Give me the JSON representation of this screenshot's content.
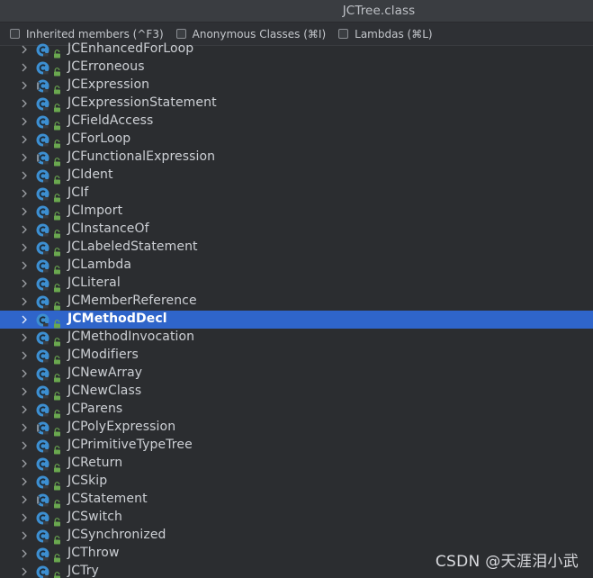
{
  "window": {
    "title": "JCTree.class"
  },
  "filters": [
    {
      "label": "Inherited members (^F3)",
      "checked": false
    },
    {
      "label": "Anonymous Classes (⌘I)",
      "checked": false
    },
    {
      "label": "Lambdas (⌘L)",
      "checked": false
    }
  ],
  "tree": {
    "icon": "class-icon",
    "access_icon": "lock-icon",
    "expand_icon": "chevron-right-icon",
    "selected_index": 15,
    "items": [
      {
        "label": "JCEnhancedForLoop",
        "abstract": false
      },
      {
        "label": "JCErroneous",
        "abstract": false
      },
      {
        "label": "JCExpression",
        "abstract": true
      },
      {
        "label": "JCExpressionStatement",
        "abstract": false
      },
      {
        "label": "JCFieldAccess",
        "abstract": false
      },
      {
        "label": "JCForLoop",
        "abstract": false
      },
      {
        "label": "JCFunctionalExpression",
        "abstract": true
      },
      {
        "label": "JCIdent",
        "abstract": false
      },
      {
        "label": "JCIf",
        "abstract": false
      },
      {
        "label": "JCImport",
        "abstract": false
      },
      {
        "label": "JCInstanceOf",
        "abstract": false
      },
      {
        "label": "JCLabeledStatement",
        "abstract": false
      },
      {
        "label": "JCLambda",
        "abstract": false
      },
      {
        "label": "JCLiteral",
        "abstract": false
      },
      {
        "label": "JCMemberReference",
        "abstract": false
      },
      {
        "label": "JCMethodDecl",
        "abstract": false
      },
      {
        "label": "JCMethodInvocation",
        "abstract": false
      },
      {
        "label": "JCModifiers",
        "abstract": false
      },
      {
        "label": "JCNewArray",
        "abstract": false
      },
      {
        "label": "JCNewClass",
        "abstract": false
      },
      {
        "label": "JCParens",
        "abstract": false
      },
      {
        "label": "JCPolyExpression",
        "abstract": true
      },
      {
        "label": "JCPrimitiveTypeTree",
        "abstract": false
      },
      {
        "label": "JCReturn",
        "abstract": false
      },
      {
        "label": "JCSkip",
        "abstract": false
      },
      {
        "label": "JCStatement",
        "abstract": true
      },
      {
        "label": "JCSwitch",
        "abstract": false
      },
      {
        "label": "JCSynchronized",
        "abstract": false
      },
      {
        "label": "JCThrow",
        "abstract": false
      },
      {
        "label": "JCTry",
        "abstract": false
      }
    ]
  },
  "colors": {
    "selection": "#2f65ca",
    "class_icon": "#3d8fd1",
    "lock": "#6aa84f"
  },
  "watermark": {
    "text": "CSDN @天涯泪小武"
  }
}
